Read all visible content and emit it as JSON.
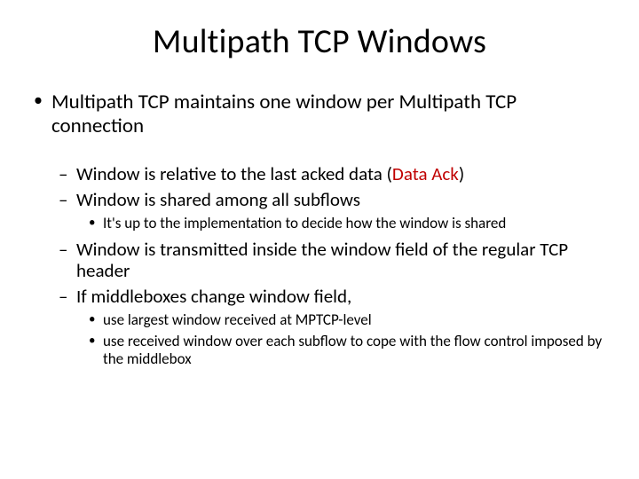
{
  "title": "Multipath TCP Windows",
  "l1_item": {
    "prefix": "Multipath TCP maintains one window per Multipath TCP connection"
  },
  "l2": {
    "a_pre": "Window is relative to the last acked data (",
    "a_red": "Data Ack",
    "a_post": ") ",
    "b": "Window is shared among all subflows",
    "c": "Window is transmitted inside the window field of the regular TCP header",
    "d": "If middleboxes change window field,"
  },
  "l3": {
    "b1": "It's up to the implementation to decide how the window is shared",
    "d1": "use largest window received at MPTCP-level",
    "d2": "use received window over each subflow to cope with the flow control imposed by the middlebox"
  }
}
